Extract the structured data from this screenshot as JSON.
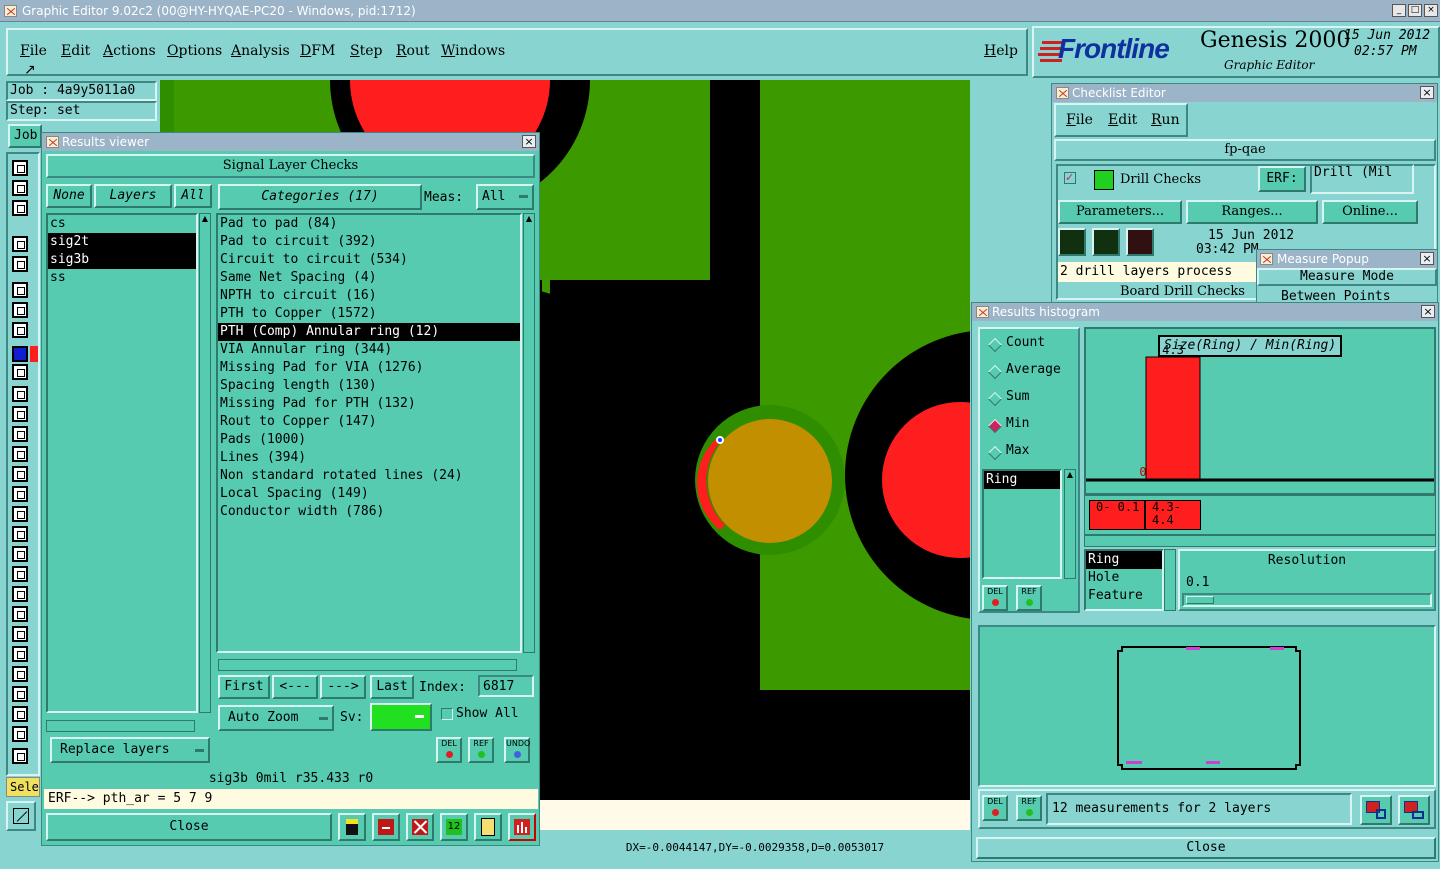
{
  "app": {
    "title": "Graphic Editor 9.02c2 (00@HY-HYQAE-PC20 - Windows, pid:1712)",
    "menu": [
      "File",
      "Edit",
      "Actions",
      "Options",
      "Analysis",
      "DFM",
      "Step",
      "Rout",
      "Windows"
    ],
    "help": "Help",
    "brand": "Frontline",
    "product": "Genesis 2000",
    "product_sub": "Graphic Editor",
    "date": "15 Jun 2012",
    "time": "02:57 PM",
    "job_label": "Job : 4a9y5011a0",
    "step_label": "Step: set",
    "job_btn": "Job",
    "sele_btn": "Sele",
    "coords": "DX=-0.0044147,DY=-0.0029358,D=0.0053017"
  },
  "results_viewer": {
    "title": "Results viewer",
    "header": "Signal Layer Checks",
    "none_btn": "None",
    "layers_btn": "Layers",
    "all_btn": "All",
    "categories_btn": "Categories (17)",
    "meas_label": "Meas:",
    "meas_value": "All",
    "layers": [
      {
        "name": "cs",
        "selected": false
      },
      {
        "name": "sig2t",
        "selected": true
      },
      {
        "name": "sig3b",
        "selected": true
      },
      {
        "name": "ss",
        "selected": false
      }
    ],
    "categories": [
      {
        "label": "Pad to pad (84)",
        "selected": false
      },
      {
        "label": "Pad to circuit (392)",
        "selected": false
      },
      {
        "label": "Circuit to circuit (534)",
        "selected": false
      },
      {
        "label": "Same Net Spacing (4)",
        "selected": false
      },
      {
        "label": "NPTH to circuit (16)",
        "selected": false
      },
      {
        "label": "PTH to Copper (1572)",
        "selected": false
      },
      {
        "label": "PTH (Comp) Annular ring (12)",
        "selected": true
      },
      {
        "label": "VIA Annular ring (344)",
        "selected": false
      },
      {
        "label": "Missing Pad for VIA (1276)",
        "selected": false
      },
      {
        "label": "Spacing length (130)",
        "selected": false
      },
      {
        "label": "Missing Pad for PTH (132)",
        "selected": false
      },
      {
        "label": "Rout to Copper (147)",
        "selected": false
      },
      {
        "label": "Pads (1000)",
        "selected": false
      },
      {
        "label": "Lines (394)",
        "selected": false
      },
      {
        "label": "Non standard rotated lines (24)",
        "selected": false
      },
      {
        "label": "Local Spacing (149)",
        "selected": false
      },
      {
        "label": "Conductor width (786)",
        "selected": false
      }
    ],
    "first_btn": "First",
    "prev_btn": "<---",
    "next_btn": "--->",
    "last_btn": "Last",
    "index_label": "Index:",
    "index_value": "6817",
    "auto_zoom": "Auto Zoom",
    "sv_label": "Sv:",
    "show_all": "Show All",
    "replace_layers": "Replace layers",
    "status_line": "sig3b 0mil   r35.433  r0",
    "erf_line": "ERF--> pth_ar = 5 7 9",
    "close_btn": "Close",
    "del": "DEL",
    "ref": "REF",
    "undo": "UNDO"
  },
  "checklist": {
    "title": "Checklist Editor",
    "menu": [
      "File",
      "Edit",
      "Run"
    ],
    "name": "fp-qae",
    "item": "Drill Checks",
    "erf_label": "ERF:",
    "erf_value": "Drill (Mil",
    "params_btn": "Parameters...",
    "ranges_btn": "Ranges...",
    "online_btn": "Online...",
    "run_date": "15 Jun 2012",
    "run_time": "03:42 PM",
    "message": "2 drill layers process",
    "item2": "Board Drill Checks"
  },
  "measure_popup": {
    "title": "Measure Popup",
    "mode_label": "Measure Mode",
    "option": "Between Points"
  },
  "histogram": {
    "title": "Results histogram",
    "stats": [
      {
        "label": "Count",
        "selected": false
      },
      {
        "label": "Average",
        "selected": false
      },
      {
        "label": "Sum",
        "selected": false
      },
      {
        "label": "Min",
        "selected": true
      },
      {
        "label": "Max",
        "selected": false
      }
    ],
    "list_item": "Ring",
    "chart_title": "Size(Ring) / Min(Ring)",
    "bar_labels": [
      "0",
      "4.3"
    ],
    "bin_labels": [
      "0- 0.1",
      "4.3- 4.4"
    ],
    "types": [
      {
        "label": "Ring",
        "selected": true
      },
      {
        "label": "Hole",
        "selected": false
      },
      {
        "label": "Feature",
        "selected": false
      }
    ],
    "resolution_label": "Resolution",
    "resolution_value": "0.1",
    "summary": "12 measurements for 2 layers",
    "close_btn": "Close",
    "colors": {
      "bar": "#ff1e1e",
      "panel": "#56cbb0"
    }
  },
  "chart_data": {
    "type": "bar",
    "categories": [
      "0-0.1",
      "4.3-4.4"
    ],
    "values": [
      0,
      4.3
    ],
    "title": "Size(Ring) / Min(Ring)",
    "xlabel": "",
    "ylabel": ""
  }
}
